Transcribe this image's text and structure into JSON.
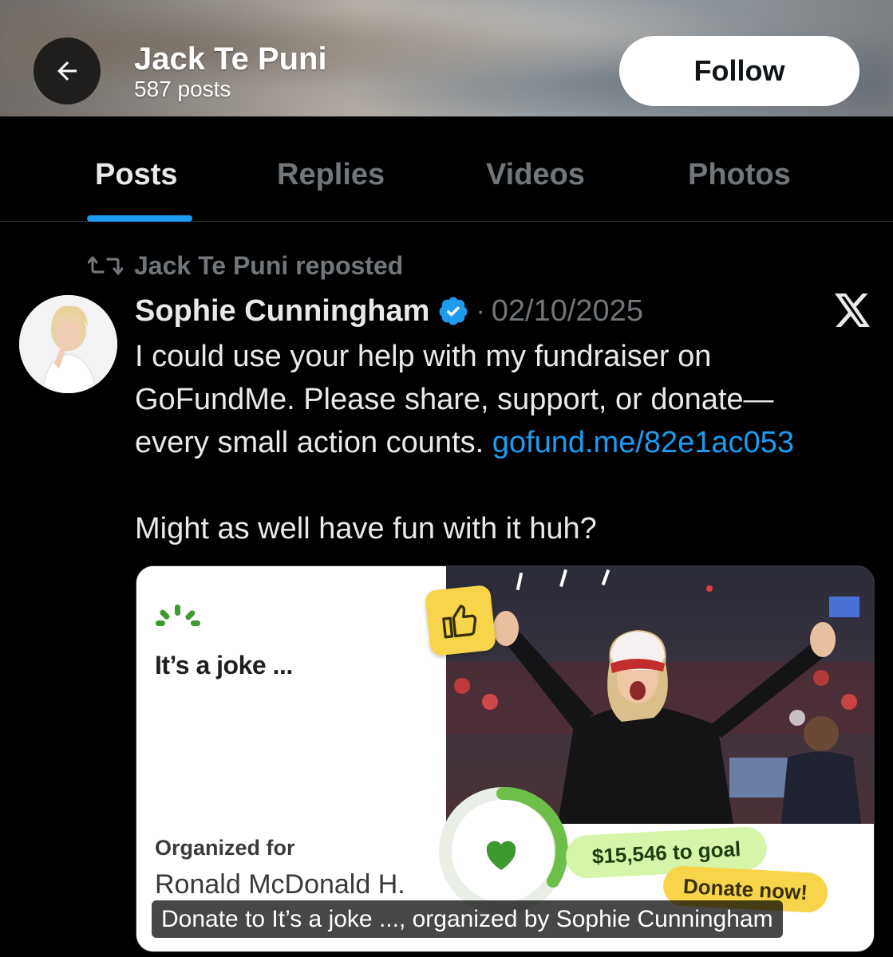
{
  "header": {
    "title": "Jack Te Puni",
    "post_count": "587 posts",
    "follow_label": "Follow"
  },
  "tabs": [
    {
      "label": "Posts",
      "active": true
    },
    {
      "label": "Replies",
      "active": false
    },
    {
      "label": "Videos",
      "active": false
    },
    {
      "label": "Photos",
      "active": false
    }
  ],
  "post": {
    "repost_text": "Jack Te Puni reposted",
    "author": "Sophie Cunningham",
    "separator": "·",
    "date": "02/10/2025",
    "body_line1": "I could use your help with my fundraiser on",
    "body_line2": "GoFundMe. Please share, support, or donate—",
    "body_line3_text": "every small action counts. ",
    "body_link": "gofund.me/82e1ac053",
    "body_line4": "Might as well have fun with it huh?"
  },
  "card": {
    "headline": "It’s a joke ...",
    "organized_label": "Organized for",
    "organized_name": "Ronald McDonald H.",
    "goal_text": "$15,546 to goal",
    "donate_text": "Donate now!",
    "caption": "Donate to It’s a joke ..., organized by Sophie Cunningham"
  },
  "colors": {
    "accent": "#1d9bf0",
    "muted": "#71767b",
    "gofundme_green": "#3d9a2f",
    "goal_pill": "#d6f5a8",
    "donate_pill": "#f7d44a"
  },
  "icons": [
    "back-arrow-icon",
    "repost-icon",
    "verified-badge-icon",
    "x-logo-icon",
    "gofundme-logo-icon",
    "thumbs-up-icon",
    "heart-icon"
  ]
}
